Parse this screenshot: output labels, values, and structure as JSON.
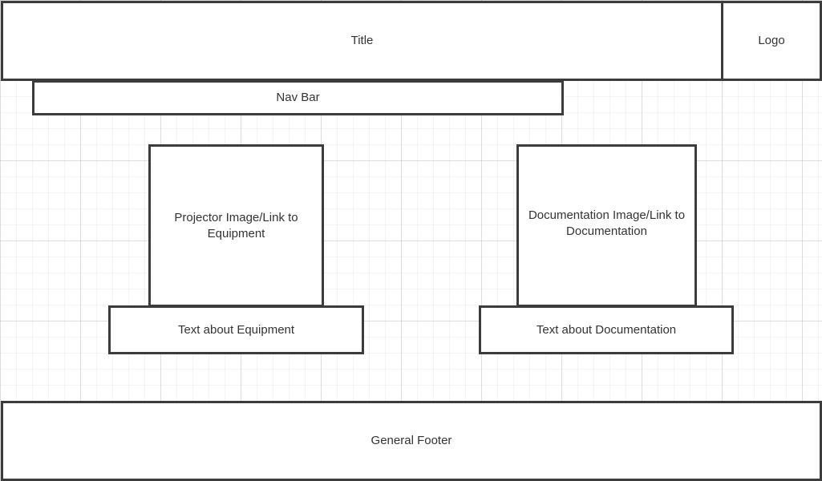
{
  "header": {
    "title": "Title",
    "logo": "Logo"
  },
  "nav": {
    "label": "Nav Bar"
  },
  "equipment": {
    "image_link_label": "Projector Image/Link to Equipment",
    "text_label": "Text about Equipment"
  },
  "documentation": {
    "image_link_label": "Documentation Image/Link to Documentation",
    "text_label": "Text about Documentation"
  },
  "footer": {
    "label": "General Footer"
  }
}
